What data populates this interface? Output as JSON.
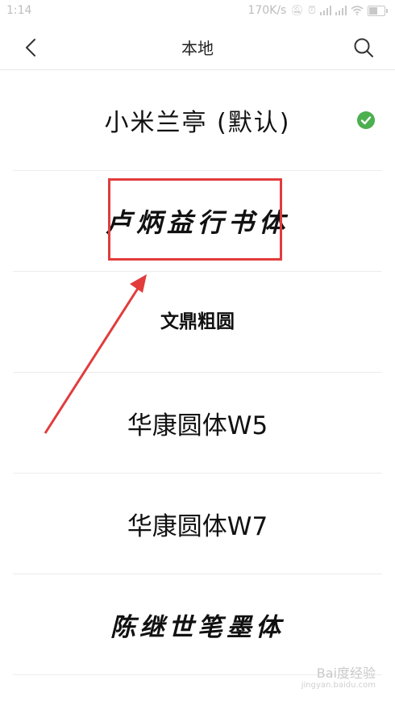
{
  "status_bar": {
    "time": "1:14",
    "network_speed": "170K/s",
    "icons": [
      "mute-icon",
      "alarm-icon",
      "signal-icon",
      "signal-icon",
      "wifi-icon",
      "battery-icon"
    ],
    "battery_level": 0.6
  },
  "header": {
    "title": "本地",
    "back_icon": "chevron-left-icon",
    "search_icon": "search-icon"
  },
  "fonts": [
    {
      "label": "小米兰亭 (默认)",
      "selected": true
    },
    {
      "label": "卢炳益行书体",
      "selected": false
    },
    {
      "label": "文鼎粗圆",
      "selected": false
    },
    {
      "label": "华康圆体W5",
      "selected": false
    },
    {
      "label": "华康圆体W7",
      "selected": false
    },
    {
      "label": "陈继世笔墨体",
      "selected": false
    }
  ],
  "annotation": {
    "highlight_color": "#e23c3c",
    "arrow_color": "#e23c3c"
  },
  "accent_color": "#4caf50",
  "watermark": {
    "text": "Bai度经验",
    "sub": "jingyan.baidu.com"
  }
}
